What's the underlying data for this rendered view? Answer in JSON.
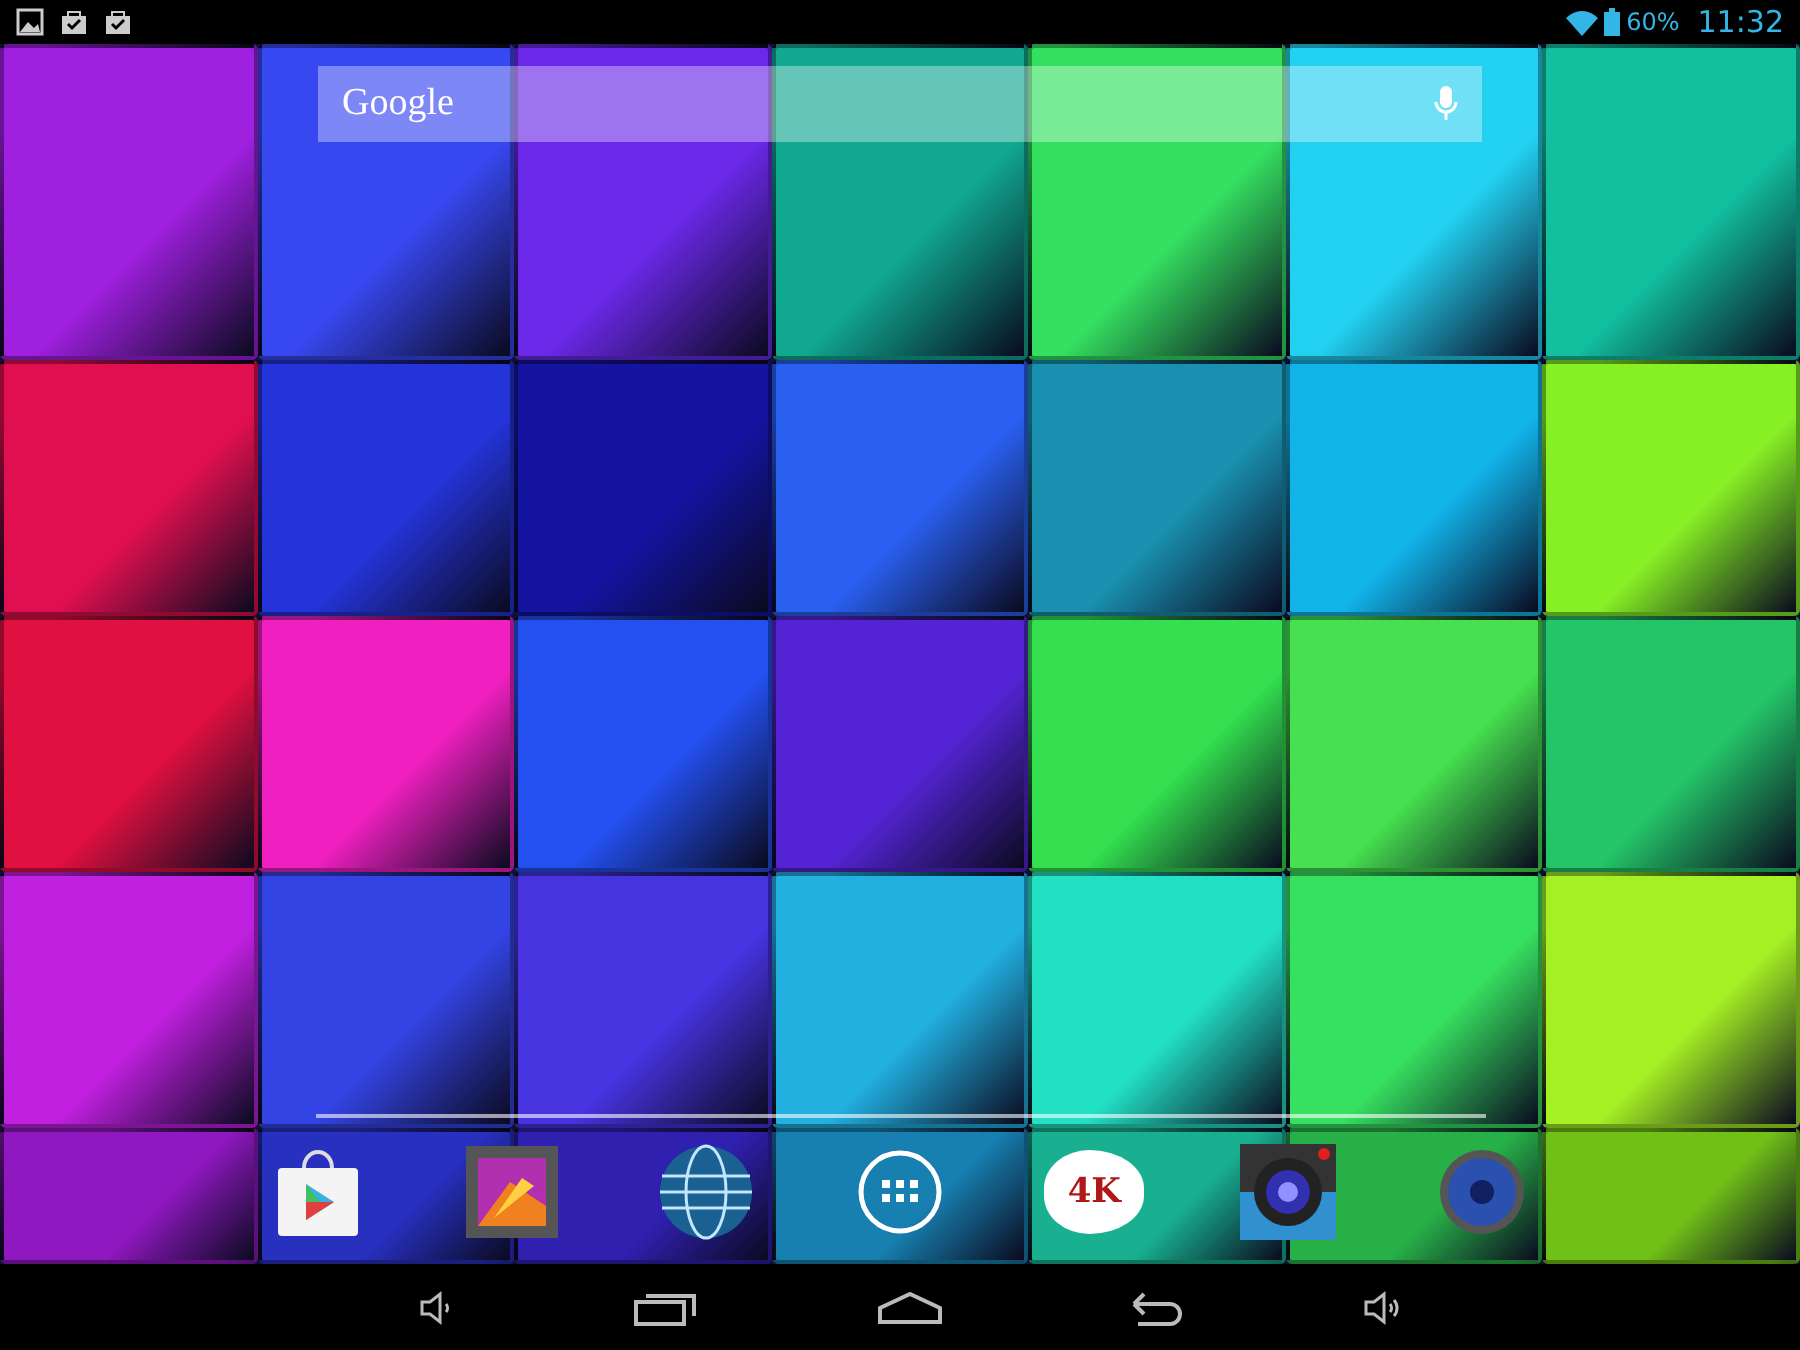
{
  "status_bar": {
    "battery": "60%",
    "time": "11:32"
  },
  "search": {
    "label": "Google"
  },
  "dock": [
    {
      "kind": "store"
    },
    {
      "kind": "gallery"
    },
    {
      "kind": "globe"
    },
    {
      "kind": "drawer"
    },
    {
      "kind": "video",
      "text": "4K"
    },
    {
      "kind": "camera"
    },
    {
      "kind": "speaker"
    }
  ],
  "nav_bar": [
    {
      "kind": "volume-down"
    },
    {
      "kind": "recents"
    },
    {
      "kind": "home"
    },
    {
      "kind": "back"
    },
    {
      "kind": "volume-up"
    }
  ]
}
